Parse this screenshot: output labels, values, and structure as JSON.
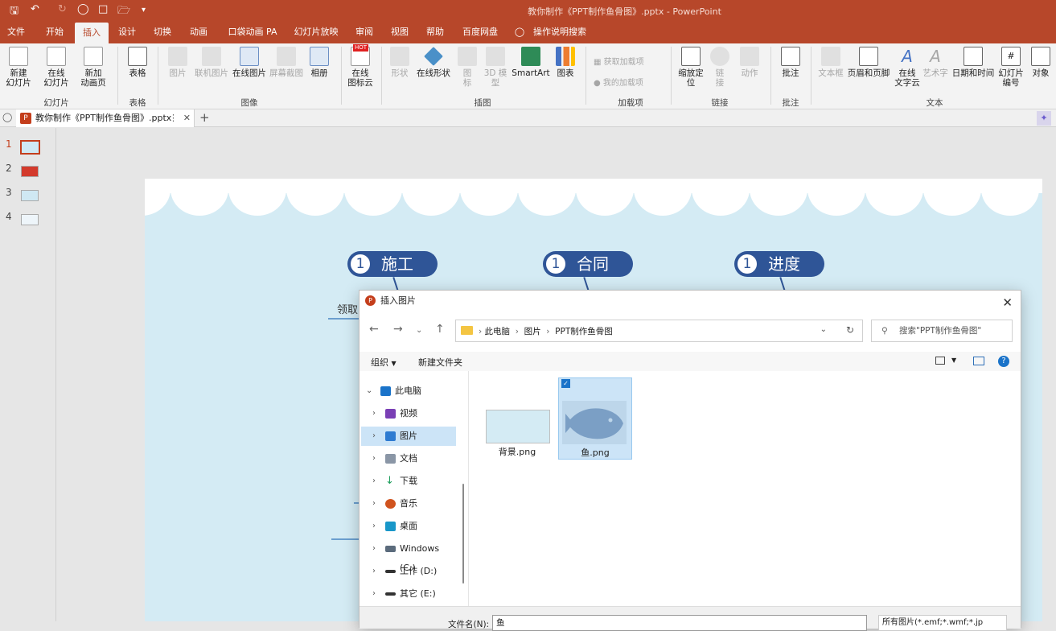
{
  "window_title": "教你制作《PPT制作鱼骨图》.pptx  -  PowerPoint",
  "tabs": [
    "文件",
    "开始",
    "插入",
    "设计",
    "切换",
    "动画",
    "口袋动画 PA",
    "幻灯片放映",
    "审阅",
    "视图",
    "帮助",
    "百度网盘",
    "操作说明搜索"
  ],
  "ribbon": {
    "buttons": [
      "新建\n幻灯片",
      "在线\n幻灯片",
      "新加\n动画页",
      "表格",
      "图片",
      "联机图片",
      "在线图片",
      "屏幕截图",
      "相册",
      "在线\n图标云",
      "形状",
      "在线形状",
      "图\n标",
      "3D 模\n型",
      "SmartArt",
      "图表",
      "获取加载项",
      "我的加载项",
      "缩放定\n位",
      "链\n接",
      "动作",
      "批注",
      "文本框",
      "页眉和页脚",
      "在线\n文字云",
      "艺术字",
      "日期和时间",
      "幻灯片\n编号",
      "对象"
    ],
    "groups": [
      "幻灯片",
      "表格",
      "图像",
      "插图",
      "加载项",
      "链接",
      "批注",
      "文本"
    ],
    "hot_badge": "HOT",
    "colors": {
      "titlebar": "#b7472a",
      "accent": "#2f5597"
    }
  },
  "doc_tab": "教你制作《PPT制作鱼骨图》.pptx",
  "thumbnails": [
    "1",
    "2",
    "3",
    "4"
  ],
  "slide": {
    "pills": [
      {
        "num": "1",
        "label": "施工"
      },
      {
        "num": "1",
        "label": "合同"
      },
      {
        "num": "1",
        "label": "进度"
      }
    ],
    "left_text": "领取"
  },
  "dialog": {
    "title": "插入图片",
    "breadcrumb": [
      "此电脑",
      "图片",
      "PPT制作鱼骨图"
    ],
    "search_placeholder": "搜索\"PPT制作鱼骨图\"",
    "organize": "组织",
    "new_folder": "新建文件夹",
    "tree": [
      {
        "label": "此电脑",
        "icon": "computer-icon"
      },
      {
        "label": "视频",
        "icon": "video-folder-icon"
      },
      {
        "label": "图片",
        "icon": "pictures-folder-icon"
      },
      {
        "label": "文档",
        "icon": "documents-folder-icon"
      },
      {
        "label": "下载",
        "icon": "downloads-folder-icon"
      },
      {
        "label": "音乐",
        "icon": "music-folder-icon"
      },
      {
        "label": "桌面",
        "icon": "desktop-folder-icon"
      },
      {
        "label": "Windows (C:)",
        "icon": "drive-icon"
      },
      {
        "label": "工作 (D:)",
        "icon": "drive-icon"
      },
      {
        "label": "其它 (E:)",
        "icon": "drive-icon"
      }
    ],
    "files": [
      {
        "name": "背景.png",
        "selected": false
      },
      {
        "name": "鱼.png",
        "selected": true
      }
    ],
    "filename_label": "文件名(N):",
    "filename_value": "鱼",
    "filetype_value": "所有图片(*.emf;*.wmf;*.jp"
  }
}
